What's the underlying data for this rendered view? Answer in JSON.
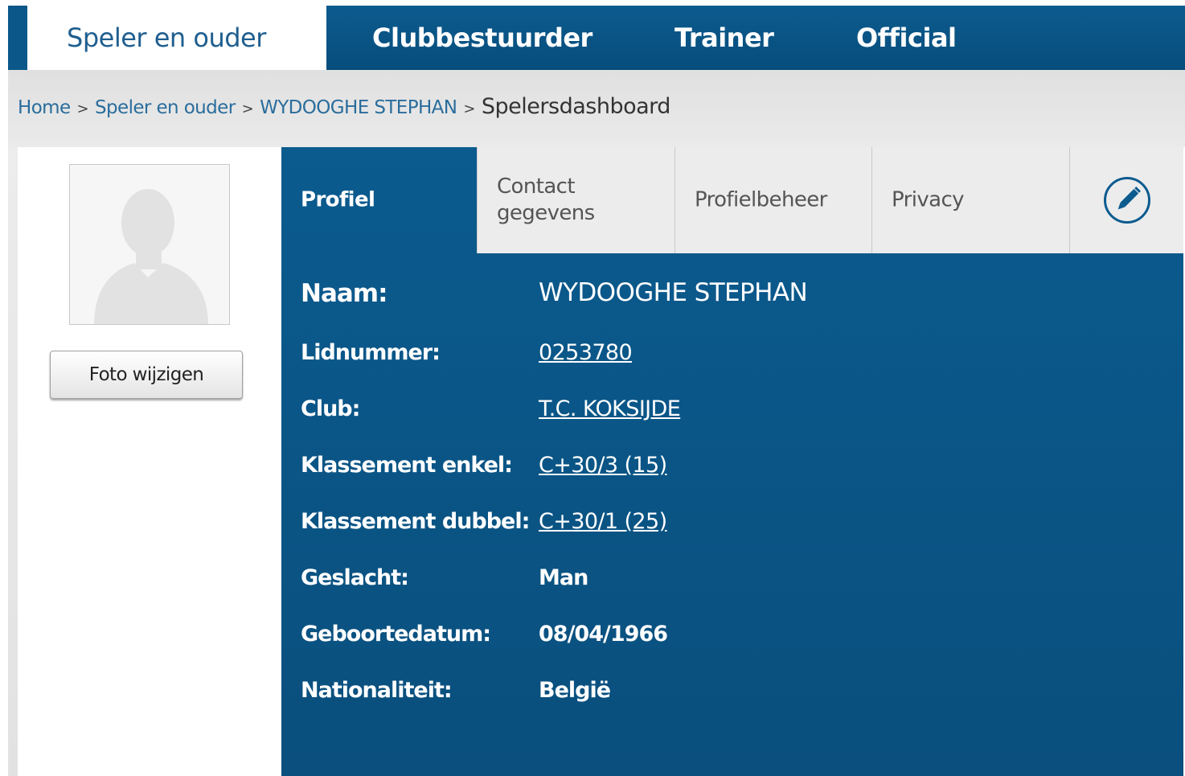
{
  "nav": {
    "items": [
      {
        "label": "Speler en ouder",
        "active": true
      },
      {
        "label": "Clubbestuurder",
        "active": false
      },
      {
        "label": "Trainer",
        "active": false
      },
      {
        "label": "Official",
        "active": false
      }
    ]
  },
  "breadcrumb": {
    "home": "Home",
    "section": "Speler en ouder",
    "person": "WYDOOGHE STEPHAN",
    "current": "Spelersdashboard",
    "separator": ">"
  },
  "sidebar": {
    "photo_button": "Foto wijzigen"
  },
  "tabs": {
    "profiel": "Profiel",
    "contact_line1": "Contact",
    "contact_line2": "gegevens",
    "profielbeheer": "Profielbeheer",
    "privacy": "Privacy"
  },
  "profile": {
    "naam_label": "Naam:",
    "naam_value": "WYDOOGHE STEPHAN",
    "lidnummer_label": "Lidnummer:",
    "lidnummer_value": "0253780",
    "club_label": "Club:",
    "club_value": "T.C. KOKSIJDE",
    "klassement_enkel_label": "Klassement enkel:",
    "klassement_enkel_value": "C+30/3 (15)",
    "klassement_dubbel_label": "Klassement dubbel:",
    "klassement_dubbel_value": "C+30/1 (25)",
    "geslacht_label": "Geslacht:",
    "geslacht_value": "Man",
    "geboortedatum_label": "Geboortedatum:",
    "geboortedatum_value": "08/04/1966",
    "nationaliteit_label": "Nationaliteit:",
    "nationaliteit_value": "België"
  },
  "colors": {
    "primary": "#0b5b8f",
    "tab_inactive": "#ececec",
    "link_blue": "#2a6d9c"
  },
  "icons": {
    "avatar": "avatar-silhouette-icon",
    "edit": "pencil-icon"
  }
}
